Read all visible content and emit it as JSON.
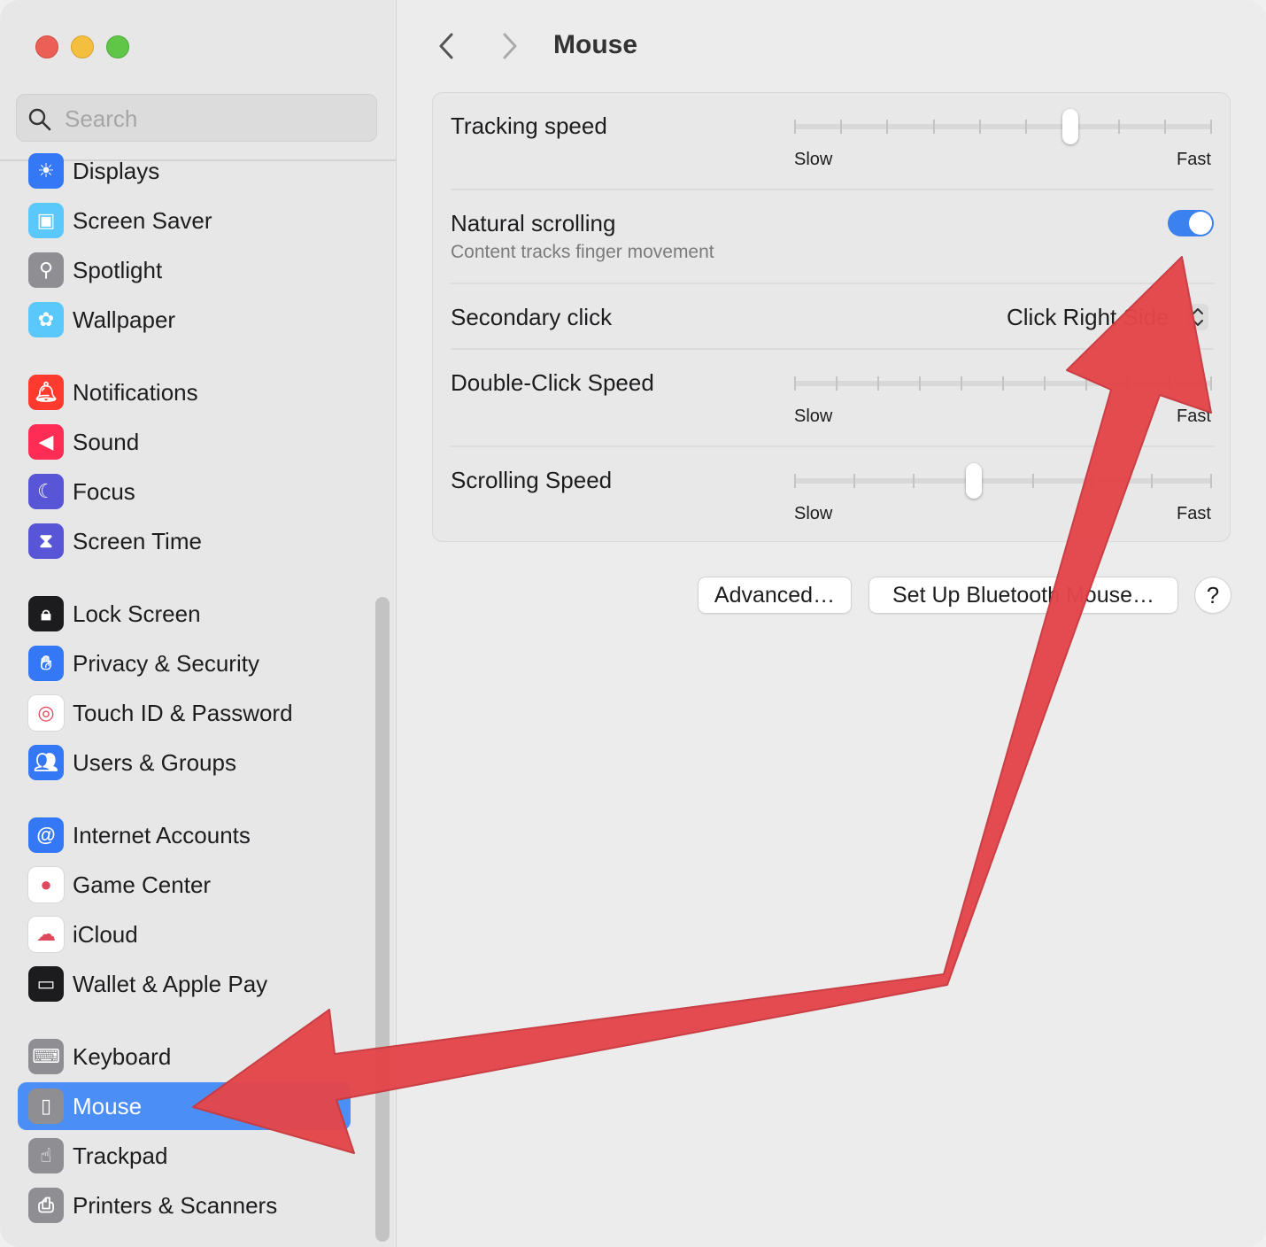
{
  "sidebar": {
    "search_placeholder": "Search",
    "items": [
      {
        "label": "Displays",
        "icon": "sun-icon",
        "color": "#3478f6"
      },
      {
        "label": "Screen Saver",
        "icon": "screen-saver-icon",
        "color": "#5ac8fa"
      },
      {
        "label": "Spotlight",
        "icon": "magnifier-icon",
        "color": "#8e8e93"
      },
      {
        "label": "Wallpaper",
        "icon": "flower-icon",
        "color": "#5ac8fa"
      },
      {
        "label": "Notifications",
        "icon": "bell-icon",
        "color": "#ff3b30"
      },
      {
        "label": "Sound",
        "icon": "speaker-icon",
        "color": "#ff2d55"
      },
      {
        "label": "Focus",
        "icon": "moon-icon",
        "color": "#5856d6"
      },
      {
        "label": "Screen Time",
        "icon": "hourglass-icon",
        "color": "#5856d6"
      },
      {
        "label": "Lock Screen",
        "icon": "lock-icon",
        "color": "#1c1c1e"
      },
      {
        "label": "Privacy & Security",
        "icon": "hand-icon",
        "color": "#3478f6"
      },
      {
        "label": "Touch ID & Password",
        "icon": "fingerprint-icon",
        "color": "#ffffff"
      },
      {
        "label": "Users & Groups",
        "icon": "users-icon",
        "color": "#3478f6"
      },
      {
        "label": "Internet Accounts",
        "icon": "at-sign-icon",
        "color": "#3478f6"
      },
      {
        "label": "Game Center",
        "icon": "game-center-icon",
        "color": "#ffffff"
      },
      {
        "label": "iCloud",
        "icon": "cloud-icon",
        "color": "#ffffff"
      },
      {
        "label": "Wallet & Apple Pay",
        "icon": "wallet-icon",
        "color": "#1c1c1e"
      },
      {
        "label": "Keyboard",
        "icon": "keyboard-icon",
        "color": "#8e8e93"
      },
      {
        "label": "Mouse",
        "icon": "mouse-icon",
        "color": "#8e8e93",
        "selected": true
      },
      {
        "label": "Trackpad",
        "icon": "trackpad-icon",
        "color": "#8e8e93"
      },
      {
        "label": "Printers & Scanners",
        "icon": "printer-icon",
        "color": "#8e8e93"
      }
    ]
  },
  "header": {
    "title": "Mouse"
  },
  "settings": {
    "tracking": {
      "label": "Tracking speed",
      "slow": "Slow",
      "fast": "Fast",
      "ticks": 10,
      "value_fraction": 0.66
    },
    "natural": {
      "label": "Natural scrolling",
      "sub": "Content tracks finger movement",
      "on": true
    },
    "secondary": {
      "label": "Secondary click",
      "value": "Click Right Side"
    },
    "doubleclick": {
      "label": "Double-Click Speed",
      "slow": "Slow",
      "fast": "Fast",
      "ticks": 11
    },
    "scrolling": {
      "label": "Scrolling Speed",
      "slow": "Slow",
      "fast": "Fast",
      "ticks": 8,
      "value_fraction": 0.43
    }
  },
  "buttons": {
    "advanced": "Advanced…",
    "bluetooth": "Set Up Bluetooth Mouse…",
    "help": "?"
  },
  "colors": {
    "accent": "#3b82f0",
    "selection": "#4b8ef5",
    "annotation_arrow": "#e3464b"
  }
}
